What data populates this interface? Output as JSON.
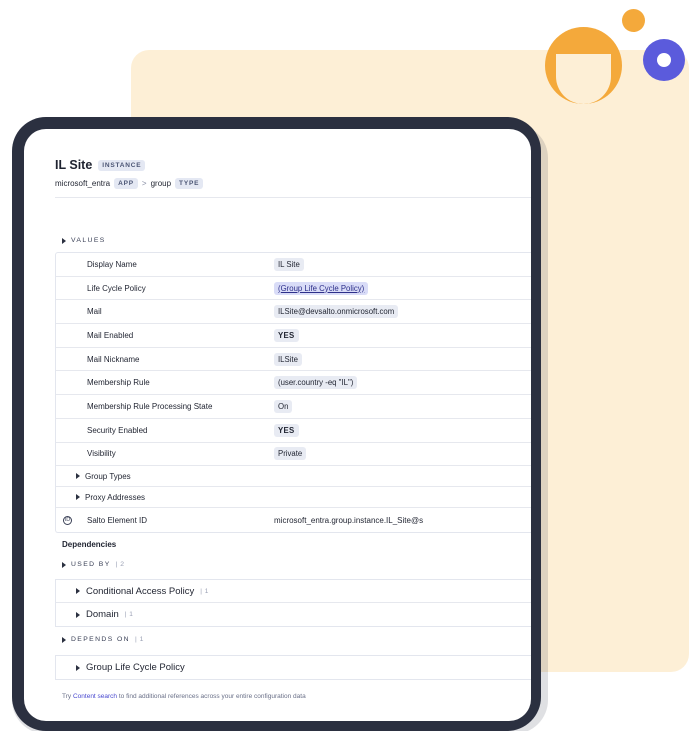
{
  "header": {
    "title": "IL Site",
    "title_badge": "INSTANCE",
    "breadcrumb": {
      "app_name": "microsoft_entra",
      "app_badge": "APP",
      "separator": ">",
      "type_name": "group",
      "type_badge": "TYPE"
    }
  },
  "values_section": {
    "label": "VALUES",
    "rows": [
      {
        "key": "Display Name",
        "value": "IL Site",
        "style": "plain"
      },
      {
        "key": "Life Cycle Policy",
        "value": "(Group Life Cycle Policy)",
        "style": "link"
      },
      {
        "key": "Mail",
        "value": "ILSite@devsalto.onmicrosoft.com",
        "style": "plain"
      },
      {
        "key": "Mail Enabled",
        "value": "YES",
        "style": "bold"
      },
      {
        "key": "Mail Nickname",
        "value": "ILSite",
        "style": "plain"
      },
      {
        "key": "Membership Rule",
        "value": "(user.country -eq \"IL\")",
        "style": "plain"
      },
      {
        "key": "Membership Rule Processing State",
        "value": "On",
        "style": "plain"
      },
      {
        "key": "Security Enabled",
        "value": "YES",
        "style": "bold"
      },
      {
        "key": "Visibility",
        "value": "Private",
        "style": "plain"
      }
    ],
    "expandable": [
      "Group Types",
      "Proxy Addresses"
    ],
    "element_id": {
      "icon": "id-icon",
      "icon_glyph": "ID",
      "key": "Salto Element ID",
      "value": "microsoft_entra.group.instance.IL_Site@s"
    }
  },
  "dependencies": {
    "title": "Dependencies",
    "used_by": {
      "label": "USED BY",
      "count": "| 2",
      "items": [
        {
          "label": "Conditional Access Policy",
          "count": "| 1"
        },
        {
          "label": "Domain",
          "count": "| 1"
        }
      ]
    },
    "depends_on": {
      "label": "DEPENDS ON",
      "count": "| 1",
      "items": [
        {
          "label": "Group Life Cycle Policy"
        }
      ]
    }
  },
  "footer": {
    "prefix": "Try",
    "link": "Content search",
    "suffix": "to find additional references across your entire configuration data"
  },
  "colors": {
    "accent": "#5b5bdc",
    "orange": "#f4a93b",
    "cream": "#fdefd6",
    "device": "#2b3040"
  }
}
